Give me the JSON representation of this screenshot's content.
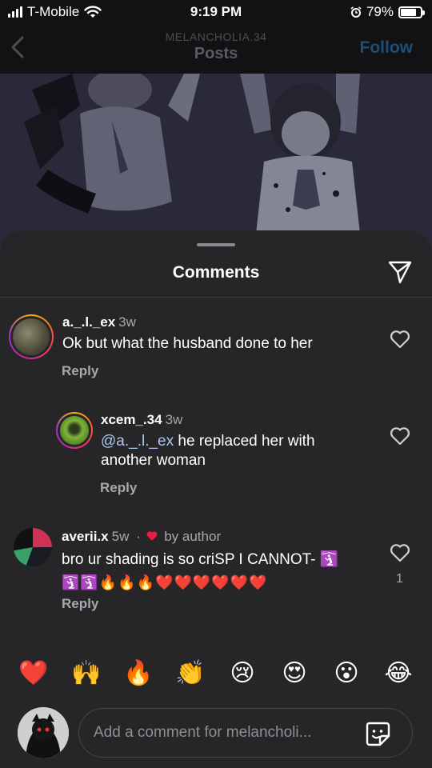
{
  "status_bar": {
    "carrier": "T-Mobile",
    "time": "9:19 PM",
    "battery": "79%",
    "battery_level": 0.79
  },
  "header": {
    "account": "MELANCHOLIA.34",
    "title": "Posts",
    "follow_label": "Follow"
  },
  "sheet": {
    "title": "Comments"
  },
  "comments": [
    {
      "user": "a._.l._ex",
      "time": "3w",
      "text": "Ok but what the husband done to her",
      "reply_label": "Reply"
    },
    {
      "user": "xcem_.34",
      "time": "3w",
      "mention": "@a._.l._ex",
      "text_line1": " he replaced her with",
      "text_line2": "another woman",
      "reply_label": "Reply"
    },
    {
      "user": "averii.x",
      "time": "5w",
      "separator": "·",
      "author_tag": "by author",
      "text_line1": "bro ur shading is so criSP I CANNOT- 🛐",
      "text_line2": "🛐🛐🔥🔥🔥❤️❤️❤️❤️❤️❤️",
      "likes": "1",
      "reply_label": "Reply"
    }
  ],
  "emoji_bar": [
    "❤️",
    "🙌",
    "🔥",
    "👏",
    "😢",
    "😍",
    "😮",
    "😂"
  ],
  "composer": {
    "placeholder": "Add a comment for melancholi..."
  },
  "colors": {
    "background": "#262628",
    "mention": "#a9c6f0",
    "follow": "#1d4e7a",
    "secondary_text": "#a8a8ac"
  }
}
